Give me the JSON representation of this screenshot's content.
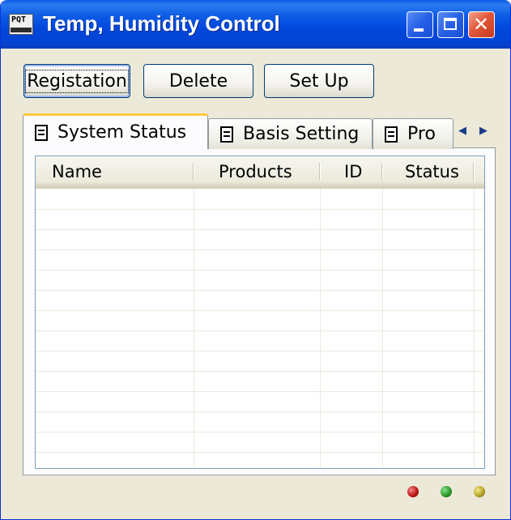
{
  "window": {
    "title": "Temp, Humidity Control",
    "icon": "app-logo-icon",
    "icon_text": "PQT",
    "controls": [
      "minimize-icon",
      "maximize-icon",
      "close-icon"
    ],
    "close_glyph": "✕"
  },
  "toolbar": {
    "registation_label": "Registation",
    "delete_label": "Delete",
    "setup_label": "Set Up"
  },
  "tabs": [
    {
      "label": "System Status",
      "active": true,
      "icon": "document-icon"
    },
    {
      "label": "Basis Setting",
      "active": false,
      "icon": "document-icon"
    },
    {
      "label": "Pro",
      "active": false,
      "icon": "document-icon"
    }
  ],
  "tab_scroll": {
    "left": "◀",
    "right": "▶"
  },
  "list": {
    "columns": [
      "Name",
      "Products",
      "ID",
      "Status"
    ],
    "rows": []
  },
  "status_leds": [
    {
      "name": "red",
      "color": "#c01818"
    },
    {
      "name": "green",
      "color": "#2a9a2a"
    },
    {
      "name": "yellow",
      "color": "#b8a42a"
    }
  ],
  "colors": {
    "titlebar": "#0046dc",
    "window_bg": "#ece9d8",
    "active_tab_accent": "#ffc83c"
  }
}
